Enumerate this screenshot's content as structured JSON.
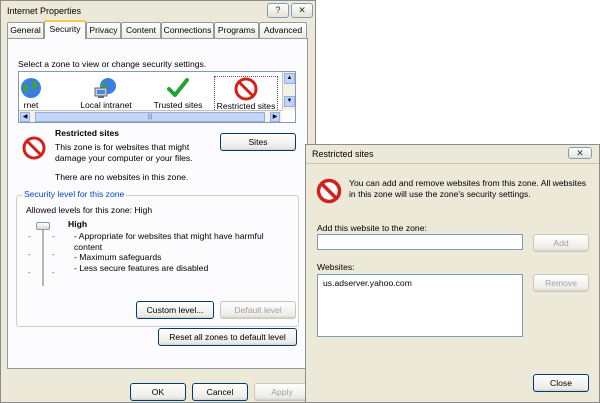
{
  "main": {
    "title": "Internet Properties",
    "help_button": "?",
    "close_button": "✕",
    "tabs": [
      "General",
      "Security",
      "Privacy",
      "Content",
      "Connections",
      "Programs",
      "Advanced"
    ],
    "active_tab": "Security",
    "zone_prompt": "Select a zone to view or change security settings.",
    "zones": [
      {
        "label": "rnet",
        "icon": "globe-icon"
      },
      {
        "label": "Local intranet",
        "icon": "local-intranet-icon"
      },
      {
        "label": "Trusted sites",
        "icon": "checkmark-icon"
      },
      {
        "label": "Restricted sites",
        "icon": "no-entry-icon"
      }
    ],
    "scroll_thumb_glyph": "|||",
    "zone_name": "Restricted sites",
    "zone_description": "This zone is for websites that might damage your computer or your files.",
    "zone_status": "There are no websites in this zone.",
    "sites_button": "Sites",
    "security_group_label": "Security level for this zone",
    "allowed_levels": "Allowed levels for this zone: High",
    "level_name": "High",
    "level_bullets": [
      "- Appropriate for websites that might have harmful content",
      "- Maximum safeguards",
      "- Less secure features are disabled"
    ],
    "custom_level_button": "Custom level...",
    "default_level_button": "Default level",
    "reset_button": "Reset all zones to default level",
    "ok_button": "OK",
    "cancel_button": "Cancel",
    "apply_button": "Apply"
  },
  "dialog": {
    "title": "Restricted sites",
    "close_button": "✕",
    "info_text": "You can add and remove websites from this zone. All websites in this zone will use the zone's security settings.",
    "add_label": "Add this website to the zone:",
    "add_value": "",
    "add_button": "Add",
    "websites_label": "Websites:",
    "websites": [
      "us.adserver.yahoo.com"
    ],
    "remove_button": "Remove",
    "close_label": "Close"
  },
  "colors": {
    "window_bg": "#ece9d8",
    "tab_highlight": "#ffc83c",
    "group_label": "#0046d5",
    "no_entry_red": "#d2201a",
    "check_green": "#21a335"
  }
}
